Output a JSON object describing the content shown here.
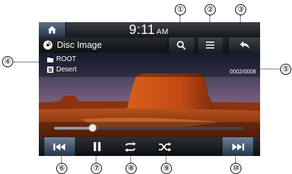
{
  "status": {
    "time": "9:11",
    "ampm": "AM"
  },
  "header": {
    "title": "Disc Image"
  },
  "browser": {
    "folder": "ROOT",
    "file": "Desert",
    "counter": "0002/0008"
  },
  "playback": {
    "progress": 0.2
  },
  "callouts": {
    "c1": "①",
    "c2": "②",
    "c3": "③",
    "c4": "④",
    "c5": "⑤",
    "c6": "⑥",
    "c7": "⑦",
    "c8": "⑧",
    "c9": "⑨",
    "c10": "⑩"
  },
  "icons": {
    "home": "home-icon",
    "search": "search-icon",
    "list": "list-icon",
    "back": "back-icon",
    "prev": "skip-previous-icon",
    "pause": "pause-icon",
    "repeat": "repeat-icon",
    "shuffle": "shuffle-icon",
    "next": "skip-next-icon"
  }
}
